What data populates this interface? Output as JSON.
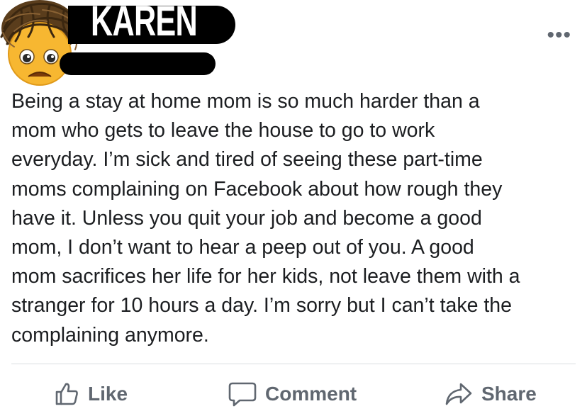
{
  "post": {
    "author_name": "KAREN",
    "text": "Being a stay at home mom is so much harder than a\nmom who gets to leave the house to go to work\neveryday. I’m sick and tired of seeing these part-time\nmoms complaining on Facebook about how rough they\nhave it. Unless you quit your job and become a good\nmom, I don’t want to hear a peep out of you. A good\nmom sacrifices her life for her kids, not leave them with a\nstranger for 10 hours a day. I’m sorry but I can’t take the\ncomplaining anymore.",
    "more_options": "•••"
  },
  "actions": {
    "like_label": "Like",
    "comment_label": "Comment",
    "share_label": "Share"
  },
  "icons": {
    "avatar": "worried-face-emoji-with-messy-hair",
    "like": "thumbs-up-icon",
    "comment": "speech-bubble-icon",
    "share": "share-arrow-icon"
  },
  "colors": {
    "text": "#1c1e21",
    "action_text": "#606770",
    "divider": "#dadde1",
    "redaction": "#000000"
  }
}
